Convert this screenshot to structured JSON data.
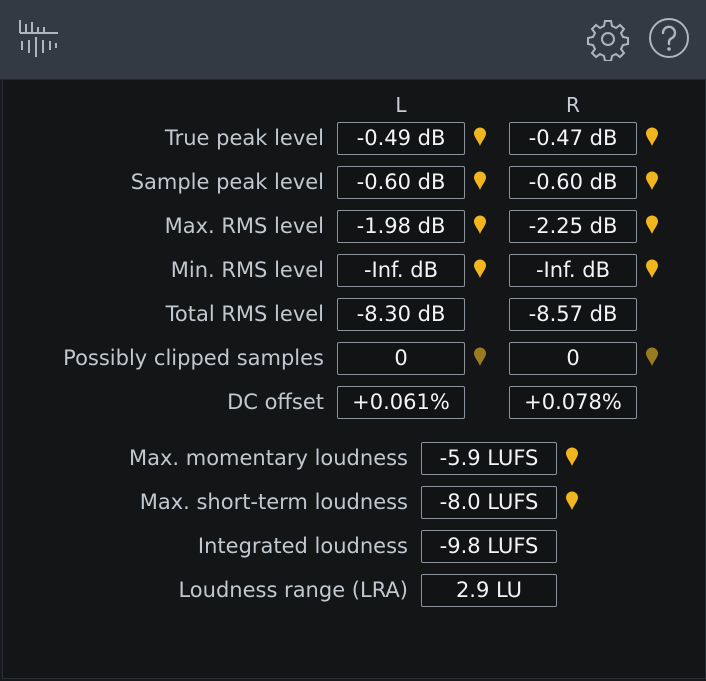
{
  "columns": {
    "left": "L",
    "right": "R"
  },
  "colors": {
    "pin_active": "#f1b61f",
    "pin_dim": "#9b7a24"
  },
  "rows": [
    {
      "label": "True peak level",
      "left": "-0.49 dB",
      "right": "-0.47 dB"
    },
    {
      "label": "Sample peak level",
      "left": "-0.60 dB",
      "right": "-0.60 dB"
    },
    {
      "label": "Max. RMS level",
      "left": "-1.98 dB",
      "right": "-2.25 dB"
    },
    {
      "label": "Min. RMS level",
      "left": "-Inf. dB",
      "right": "-Inf. dB"
    },
    {
      "label": "Total RMS level",
      "left": "-8.30 dB",
      "right": "-8.57 dB"
    },
    {
      "label": "Possibly clipped samples",
      "left": "0",
      "right": "0"
    },
    {
      "label": "DC offset",
      "left": "+0.061%",
      "right": "+0.078%"
    }
  ],
  "loudness": [
    {
      "label": "Max. momentary loudness",
      "value": "-5.9 LUFS"
    },
    {
      "label": "Max. short-term loudness",
      "value": "-8.0 LUFS"
    },
    {
      "label": "Integrated loudness",
      "value": "-9.8 LUFS"
    },
    {
      "label": "Loudness range (LRA)",
      "value": "2.9 LU"
    }
  ],
  "icons": {
    "app": "meter-icon",
    "settings": "gear-icon",
    "help": "help-icon",
    "marker": "location-pin-icon"
  }
}
